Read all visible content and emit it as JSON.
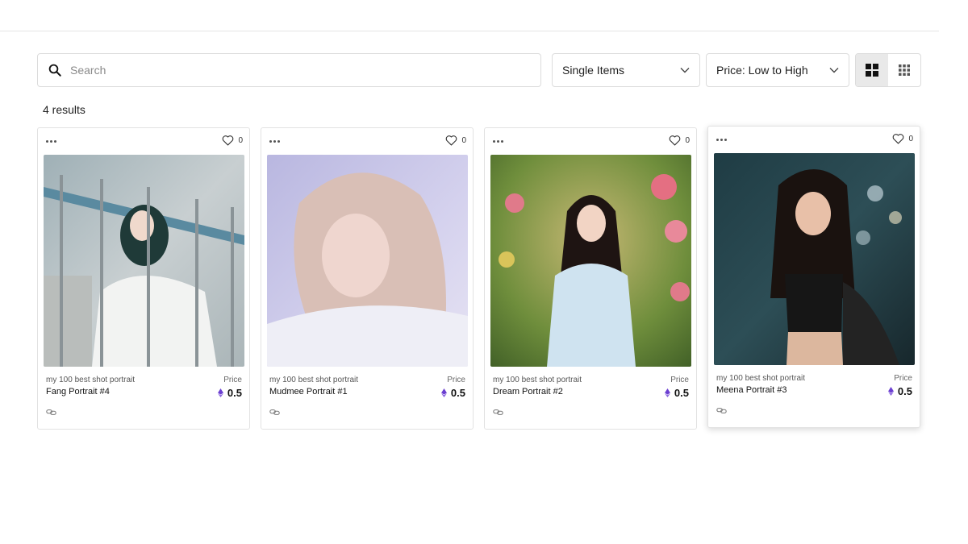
{
  "search": {
    "placeholder": "Search",
    "value": ""
  },
  "filters": {
    "item_type": "Single Items",
    "sort": "Price: Low to High"
  },
  "view": {
    "active": "large-grid"
  },
  "results_text": "4 results",
  "currency_icon": "ethereum-icon",
  "cards": [
    {
      "collection": "my 100 best shot portrait",
      "title": "Fang Portrait #4",
      "likes": "0",
      "price_label": "Price",
      "price": "0.5"
    },
    {
      "collection": "my 100 best shot portrait",
      "title": "Mudmee Portrait #1",
      "likes": "0",
      "price_label": "Price",
      "price": "0.5"
    },
    {
      "collection": "my 100 best shot portrait",
      "title": "Dream Portrait #2",
      "likes": "0",
      "price_label": "Price",
      "price": "0.5"
    },
    {
      "collection": "my 100 best shot portrait",
      "title": "Meena Portrait #3",
      "likes": "0",
      "price_label": "Price",
      "price": "0.5"
    }
  ],
  "colors": {
    "border": "#dcdcdc",
    "eth": "#6b3fd1",
    "toggle_active": "#e9e9e9"
  }
}
